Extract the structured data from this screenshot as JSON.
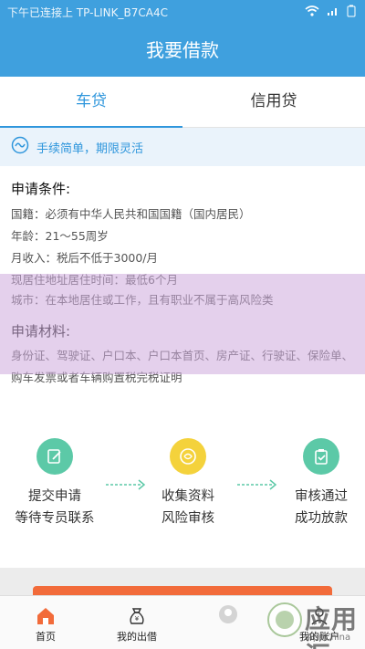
{
  "status_bar": {
    "left_text": "下午已连接上 TP-LINK_B7CA4C"
  },
  "header": {
    "title": "我要借款"
  },
  "tabs": [
    {
      "label": "车贷",
      "active": true
    },
    {
      "label": "信用贷",
      "active": false
    }
  ],
  "notice": {
    "text": "手续简单，期限灵活"
  },
  "conditions": {
    "title": "申请条件:",
    "lines": [
      "国籍：必须有中华人民共和国国籍（国内居民）",
      "年龄：21～55周岁",
      "月收入：税后不低于3000/月",
      "现居住地址居住时间：最低6个月",
      "城市：在本地居住或工作，且有职业不属于高风险类"
    ]
  },
  "materials": {
    "title": "申请材料:",
    "text": "身份证、驾驶证、户口本、户口本首页、房产证、行驶证、保险单、购车发票或者车辆购置税完税证明"
  },
  "steps": [
    {
      "icon": "edit-icon",
      "color": "#5cc9a7",
      "line1": "提交申请",
      "line2": "等待专员联系"
    },
    {
      "icon": "coin-icon",
      "color": "#f4d23c",
      "line1": "收集资料",
      "line2": "风险审核"
    },
    {
      "icon": "clipboard-icon",
      "color": "#5cc9a7",
      "line1": "审核通过",
      "line2": "成功放款"
    }
  ],
  "bottom_nav": [
    {
      "label": "首页",
      "icon": "home-icon"
    },
    {
      "label": "我的出借",
      "icon": "money-bag-icon"
    },
    {
      "label": "",
      "icon": "avatar-icon"
    },
    {
      "label": "我的账户",
      "icon": "account-icon"
    }
  ],
  "watermark": {
    "main": "应用汇",
    "sub": "AppChina"
  },
  "colors": {
    "primary": "#3fa0de",
    "accent": "#f26b3a",
    "teal": "#5cc9a7",
    "yellow": "#f4d23c"
  }
}
